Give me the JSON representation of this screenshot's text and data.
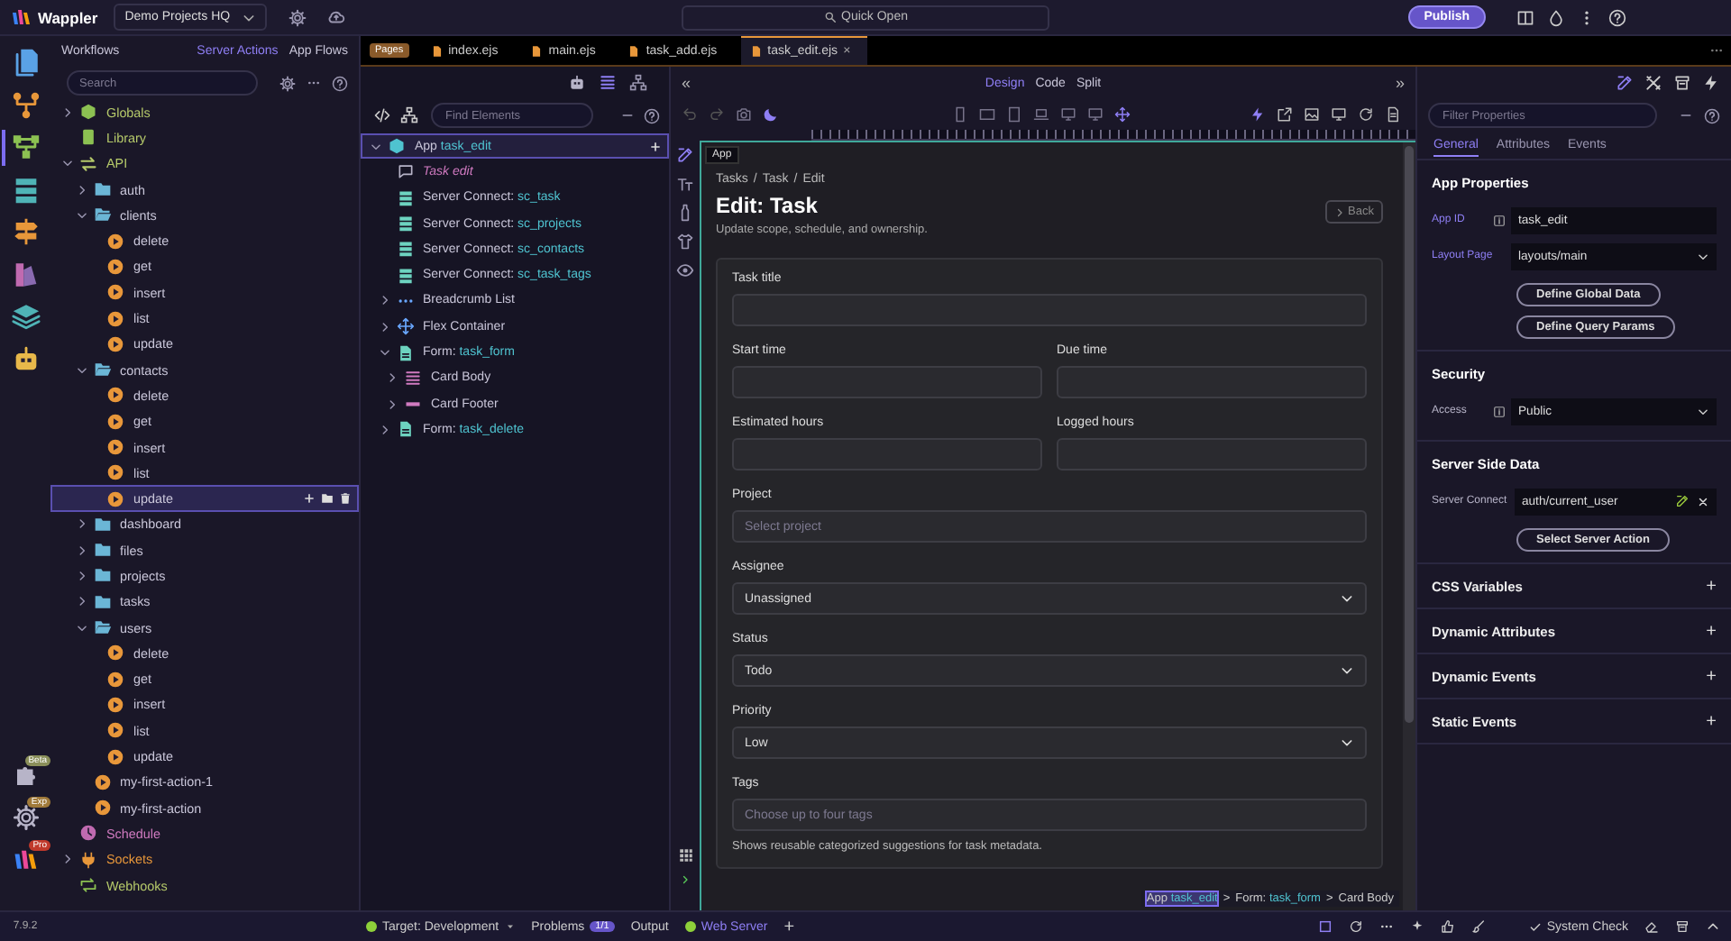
{
  "topbar": {
    "brand": "Wappler",
    "project": "Demo Projects HQ",
    "quick_open": "Quick Open",
    "publish": "Publish"
  },
  "activity_bar": {
    "items": [
      {
        "kind": "files",
        "selected": false
      },
      {
        "kind": "nodes",
        "selected": false
      },
      {
        "kind": "workflow",
        "selected": true
      },
      {
        "kind": "database",
        "selected": false
      },
      {
        "kind": "routes",
        "selected": false
      },
      {
        "kind": "design",
        "selected": false
      },
      {
        "kind": "layers",
        "selected": false
      },
      {
        "kind": "robot",
        "selected": false
      }
    ],
    "bottom": [
      {
        "kind": "extensions",
        "badge": "Beta"
      },
      {
        "kind": "settings",
        "badge": "Exp"
      },
      {
        "kind": "brand",
        "badge": "Pro"
      }
    ]
  },
  "workflows": {
    "title": "Workflows",
    "tabs": [
      {
        "label": "Server Actions",
        "selected": true
      },
      {
        "label": "App Flows",
        "selected": false
      }
    ],
    "search": {
      "placeholder": "Search"
    },
    "tree": [
      {
        "label": "Globals",
        "kind": "globals",
        "expanded": false,
        "selected": false
      },
      {
        "label": "Library",
        "kind": "library",
        "selected": false
      },
      {
        "label": "API",
        "kind": "api",
        "expanded": true,
        "selected": false,
        "children": [
          {
            "label": "auth",
            "kind": "folder",
            "expanded": false,
            "selected": false
          },
          {
            "label": "clients",
            "kind": "folder",
            "expanded": true,
            "selected": false,
            "children": [
              {
                "label": "delete",
                "kind": "action",
                "selected": false
              },
              {
                "label": "get",
                "kind": "action",
                "selected": false
              },
              {
                "label": "insert",
                "kind": "action",
                "selected": false
              },
              {
                "label": "list",
                "kind": "action",
                "selected": false
              },
              {
                "label": "update",
                "kind": "action",
                "selected": false
              }
            ]
          },
          {
            "label": "contacts",
            "kind": "folder",
            "expanded": true,
            "selected": false,
            "children": [
              {
                "label": "delete",
                "kind": "action",
                "selected": false
              },
              {
                "label": "get",
                "kind": "action",
                "selected": false
              },
              {
                "label": "insert",
                "kind": "action",
                "selected": false
              },
              {
                "label": "list",
                "kind": "action",
                "selected": false
              },
              {
                "label": "update",
                "kind": "action",
                "selected": true
              }
            ]
          },
          {
            "label": "dashboard",
            "kind": "folder",
            "expanded": false,
            "selected": false
          },
          {
            "label": "files",
            "kind": "folder",
            "expanded": false,
            "selected": false
          },
          {
            "label": "projects",
            "kind": "folder",
            "expanded": false,
            "selected": false
          },
          {
            "label": "tasks",
            "kind": "folder",
            "expanded": false,
            "selected": false
          },
          {
            "label": "users",
            "kind": "folder",
            "expanded": true,
            "selected": false,
            "children": [
              {
                "label": "delete",
                "kind": "action",
                "selected": false
              },
              {
                "label": "get",
                "kind": "action",
                "selected": false
              },
              {
                "label": "insert",
                "kind": "action",
                "selected": false
              },
              {
                "label": "list",
                "kind": "action",
                "selected": false
              },
              {
                "label": "update",
                "kind": "action",
                "selected": false
              }
            ]
          },
          {
            "label": "my-first-action-1",
            "kind": "action",
            "selected": false
          },
          {
            "label": "my-first-action",
            "kind": "action",
            "selected": false
          }
        ]
      },
      {
        "label": "Schedule",
        "kind": "schedule",
        "selected": false
      },
      {
        "label": "Sockets",
        "kind": "sockets",
        "expanded": false,
        "selected": false
      },
      {
        "label": "Webhooks",
        "kind": "webhooks",
        "selected": false
      }
    ]
  },
  "editor_tabs": {
    "badge": "Pages",
    "tabs": [
      {
        "label": "index.ejs",
        "selected": false
      },
      {
        "label": "main.ejs",
        "selected": false
      },
      {
        "label": "task_add.ejs",
        "selected": false
      },
      {
        "label": "task_edit.ejs",
        "selected": true,
        "close": "×"
      }
    ]
  },
  "structure": {
    "search": {
      "placeholder": "Find Elements"
    },
    "tree": [
      {
        "label": "App",
        "ref": "task_edit",
        "kind": "app",
        "expanded": true,
        "selected": true,
        "children": [
          {
            "label": "Task edit",
            "kind": "comment",
            "selected": false
          },
          {
            "label": "Server Connect:",
            "ref": "sc_task",
            "kind": "server-connect",
            "selected": false
          },
          {
            "label": "Server Connect:",
            "ref": "sc_projects",
            "kind": "server-connect",
            "selected": false
          },
          {
            "label": "Server Connect:",
            "ref": "sc_contacts",
            "kind": "server-connect",
            "selected": false
          },
          {
            "label": "Server Connect:",
            "ref": "sc_task_tags",
            "kind": "server-connect",
            "selected": false
          },
          {
            "label": "Breadcrumb List",
            "kind": "breadcrumb",
            "expanded": false,
            "selected": false
          },
          {
            "label": "Flex Container",
            "kind": "flex",
            "expanded": false,
            "selected": false
          },
          {
            "label": "Form:",
            "ref": "task_form",
            "kind": "form",
            "expanded": true,
            "selected": false,
            "children": [
              {
                "label": "Card Body",
                "kind": "card-body",
                "expanded": false,
                "selected": false
              },
              {
                "label": "Card Footer",
                "kind": "card-footer",
                "expanded": false,
                "selected": false
              }
            ]
          },
          {
            "label": "Form:",
            "ref": "task_delete",
            "kind": "form",
            "expanded": false,
            "selected": false
          }
        ]
      }
    ]
  },
  "view_switch": {
    "collapse_left": "«",
    "modes": [
      {
        "label": "Design",
        "selected": true
      },
      {
        "label": "Code",
        "selected": false
      },
      {
        "label": "Split",
        "selected": false
      }
    ],
    "collapse_right": "»"
  },
  "canvas": {
    "tooltip": "App",
    "breadcrumb": {
      "separator": "/",
      "items": [
        "Tasks",
        "Task",
        "Edit"
      ]
    },
    "title": "Edit: Task",
    "subtitle": "Update scope, schedule, and ownership.",
    "back": "Back",
    "rows": [
      [
        {
          "label": "Task title",
          "kind": "input"
        }
      ],
      [
        {
          "label": "Start time",
          "kind": "input"
        },
        {
          "label": "Due time",
          "kind": "input"
        }
      ],
      [
        {
          "label": "Estimated hours",
          "kind": "input"
        },
        {
          "label": "Logged hours",
          "kind": "input"
        }
      ],
      [
        {
          "label": "Project",
          "kind": "input",
          "placeholder": "Select project"
        }
      ],
      [
        {
          "label": "Assignee",
          "kind": "select",
          "value": "Unassigned"
        }
      ],
      [
        {
          "label": "Status",
          "kind": "select",
          "value": "Todo"
        }
      ],
      [
        {
          "label": "Priority",
          "kind": "select",
          "value": "Low"
        }
      ],
      [
        {
          "label": "Tags",
          "kind": "input",
          "placeholder": "Choose up to four tags",
          "help": "Shows reusable categorized suggestions for task metadata."
        }
      ]
    ]
  },
  "selection_path": {
    "separator": ">",
    "items": [
      {
        "label": "App",
        "ref": "task_edit",
        "selected": true
      },
      {
        "label": "Form:",
        "ref": "task_form",
        "selected": false
      },
      {
        "label": "Card Body",
        "selected": false
      }
    ]
  },
  "properties": {
    "search": {
      "placeholder": "Filter Properties"
    },
    "tabs": [
      {
        "label": "General",
        "selected": true
      },
      {
        "label": "Attributes",
        "selected": false
      },
      {
        "label": "Events",
        "selected": false
      }
    ],
    "sections": [
      {
        "kind": "group",
        "title": "App Properties",
        "fields": [
          {
            "label": "App ID",
            "kind": "input",
            "value": "task_edit",
            "bound": true,
            "info": true
          },
          {
            "label": "Layout Page",
            "kind": "select",
            "value": "layouts/main",
            "bound": true,
            "info": false
          }
        ],
        "buttons": [
          "Define Global Data",
          "Define Query Params"
        ]
      },
      {
        "kind": "group",
        "title": "Security",
        "fields": [
          {
            "label": "Access",
            "kind": "select",
            "value": "Public",
            "bound": false,
            "info": true
          }
        ]
      },
      {
        "kind": "group",
        "title": "Server Side Data",
        "fields": [
          {
            "label": "Server Connect",
            "kind": "picker",
            "value": "auth/current_user",
            "bound": false,
            "info": false
          }
        ],
        "buttons": [
          "Select Server Action"
        ]
      },
      {
        "kind": "collapsed",
        "title": "CSS Variables",
        "add": "+"
      },
      {
        "kind": "collapsed",
        "title": "Dynamic Attributes",
        "add": "+"
      },
      {
        "kind": "collapsed",
        "title": "Dynamic Events",
        "add": "+"
      },
      {
        "kind": "collapsed",
        "title": "Static Events",
        "add": "+"
      }
    ]
  },
  "status_bar": {
    "version": "7.9.2",
    "target": {
      "label": "Target: Development",
      "online": true
    },
    "problems": {
      "label": "Problems",
      "count": "1/1"
    },
    "output": "Output",
    "server": {
      "label": "Web Server",
      "online": true
    },
    "add": "+",
    "system_check": "System Check"
  }
}
